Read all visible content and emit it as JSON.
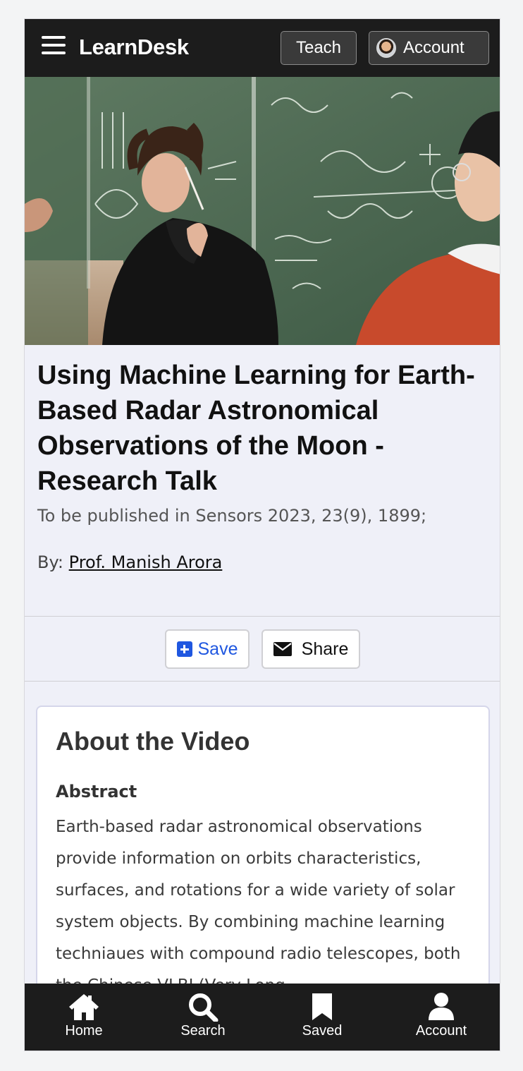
{
  "header": {
    "brand": "LearnDesk",
    "teach_label": "Teach",
    "account_label": "Account"
  },
  "video": {
    "title": "Using Machine Learning for Earth-Based Radar Astronomical Observations of the Moon - Research Talk",
    "publication_note": "To be published in Sensors 2023, 23(9), 1899;",
    "by_prefix": "By: ",
    "author": "Prof. Manish Arora"
  },
  "actions": {
    "save_label": "Save",
    "share_label": "Share"
  },
  "about": {
    "heading": "About the Video",
    "abstract_label": "Abstract",
    "abstract_text": "Earth-based radar astronomical observations provide information on orbits characteristics, surfaces, and rotations for a wide variety of solar system objects. By combining machine learning techniaues with compound radio telescopes, both the Chinese VLBI (Very Long"
  },
  "bottom_nav": {
    "items": [
      {
        "label": "Home",
        "icon": "home-icon"
      },
      {
        "label": "Search",
        "icon": "search-icon"
      },
      {
        "label": "Saved",
        "icon": "bookmark-icon"
      },
      {
        "label": "Account",
        "icon": "user-icon"
      }
    ]
  },
  "colors": {
    "header_bg": "#1c1c1c",
    "page_bg": "#eff0f8",
    "save_accent": "#1f57e0"
  }
}
